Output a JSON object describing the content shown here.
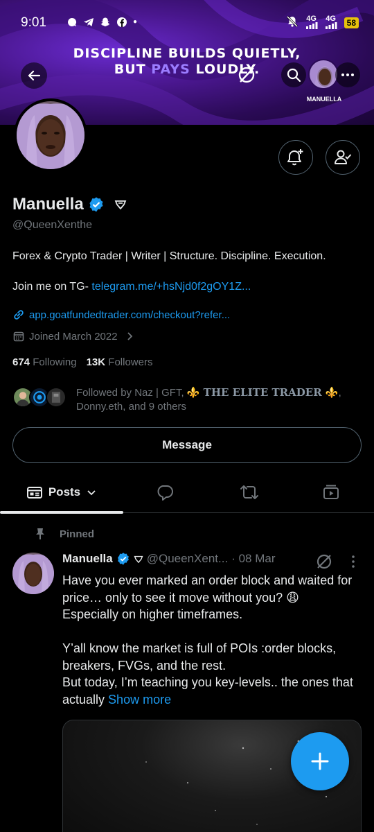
{
  "status_bar": {
    "time": "9:01",
    "network_1": "4G",
    "network_2": "4G",
    "battery": "58"
  },
  "banner": {
    "line1": "DISCIPLINE BUILDS QUIETLY,",
    "line2_a": "BUT",
    "line2_b": "PAYS",
    "line2_c": "LOUDLY.",
    "mini_name": "MANUELLA",
    "accent_color": "#9b7cff"
  },
  "profile": {
    "name": "Manuella",
    "handle": "@QueenXenthe",
    "bio": "Forex & Crypto Trader | Writer | Structure. Discipline. Execution.",
    "tg_prefix": "Join me on TG- ",
    "tg_link": "telegram.me/+hsNjd0f2gOY1Z...",
    "url": "app.goatfundedtrader.com/checkout?refer...",
    "joined": "Joined March 2022",
    "following_count": "674",
    "following_label": "Following",
    "followers_count": "13K",
    "followers_label": "Followers"
  },
  "followed_by": {
    "prefix": "Followed by Naz | GFT, ",
    "elite": "⚜️ THE ELITE TRADER ⚜️",
    "suffix": ", Donny.eth, and 9 others"
  },
  "message_button": "Message",
  "tabs": {
    "posts": "Posts"
  },
  "post": {
    "pinned_label": "Pinned",
    "name": "Manuella",
    "handle": "@QueenXent...",
    "date": "· 08 Mar",
    "line1": "Have you ever marked an order block and waited for price… only to see it move without you? 😩",
    "line2": "Especially on higher timeframes.",
    "line3": "Y’all know the market is full of POIs :order blocks, breakers, FVGs, and the rest.",
    "line4": "But today, I’m teaching you key-levels.. the ones that actually ",
    "show_more": "Show more"
  },
  "colors": {
    "accent": "#1d9bf0",
    "background": "#000000",
    "muted": "#71767b"
  }
}
